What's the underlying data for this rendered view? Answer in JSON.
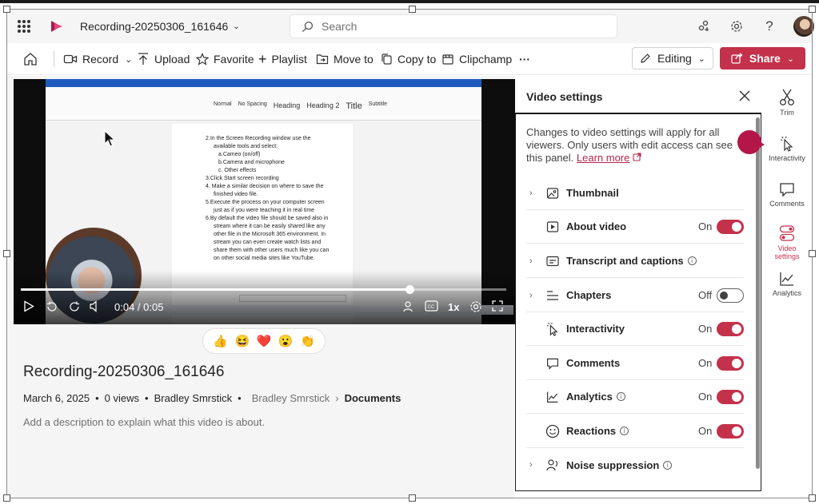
{
  "header": {
    "file_title": "Recording-20250306_161646",
    "search_placeholder": "Search"
  },
  "toolbar": {
    "record_label": "Record",
    "upload_label": "Upload",
    "favorite_label": "Favorite",
    "playlist_label": "Playlist",
    "move_label": "Move to",
    "copy_label": "Copy to",
    "clipchamp_label": "Clipchamp",
    "more_label": "···",
    "editing_label": "Editing",
    "share_label": "Share"
  },
  "player": {
    "time_display": "0:04 / 0:05",
    "progress": 0.8,
    "speed_label": "1x",
    "skip_back": "10",
    "skip_fwd": "10"
  },
  "document_in_video": {
    "ribbon_styles": [
      "Normal",
      "No Spacing",
      "Heading",
      "Heading 2",
      "Title",
      "Subtitle"
    ],
    "lines": [
      {
        "text": "2.In the Screen Recording window use the",
        "cls": ""
      },
      {
        "text": "available tools and select:",
        "cls": "ind2"
      },
      {
        "text": "a.Cameo (on/off)",
        "cls": "ind"
      },
      {
        "text": "b.Camera and microphone",
        "cls": "ind"
      },
      {
        "text": "c. Other effects",
        "cls": "ind"
      },
      {
        "text": "3.Click Start screen recording",
        "cls": ""
      },
      {
        "text": "4. Make a similar decision on where to save the",
        "cls": ""
      },
      {
        "text": "finished video file.",
        "cls": "ind2"
      },
      {
        "text": "5.Execute the process on your computer screen",
        "cls": ""
      },
      {
        "text": "just as if you were teaching it in real time",
        "cls": "ind2"
      },
      {
        "text": "6.By default the video file should be saved also in",
        "cls": ""
      },
      {
        "text": "stream where it can be easily shared like any",
        "cls": "ind2"
      },
      {
        "text": "other file in the Microsoft 365 environment. In",
        "cls": "ind2"
      },
      {
        "text": "stream you can even create watch lists and",
        "cls": "ind2"
      },
      {
        "text": "share them with other users much like you can",
        "cls": "ind2"
      },
      {
        "text": "on other social media sites like YouTube.",
        "cls": "ind2"
      }
    ]
  },
  "reactions": [
    "👍",
    "😆",
    "❤️",
    "😮",
    "👏"
  ],
  "video_info": {
    "title": "Recording-20250306_161646",
    "date": "March 6, 2025",
    "views": "0 views",
    "owner": "Bradley Smrstick",
    "location_owner": "Bradley Smrstick",
    "location_folder": "Documents",
    "description_placeholder": "Add a description to explain what this video is about."
  },
  "settings_panel": {
    "title": "Video settings",
    "info_text": "Changes to video settings will apply for all viewers. Only users with edit access can see this panel.",
    "learn_more": "Learn more",
    "rows": [
      {
        "label": "Thumbnail",
        "expandable": true,
        "state": null,
        "icon": "image-icon",
        "info": false
      },
      {
        "label": "About video",
        "expandable": false,
        "state": "On",
        "icon": "play-box-icon",
        "info": false
      },
      {
        "label": "Transcript and captions",
        "expandable": true,
        "state": null,
        "icon": "captions-icon",
        "info": true
      },
      {
        "label": "Chapters",
        "expandable": true,
        "state": "Off",
        "icon": "chapters-icon",
        "info": false
      },
      {
        "label": "Interactivity",
        "expandable": false,
        "state": "On",
        "icon": "cursor-sparkle-icon",
        "info": false
      },
      {
        "label": "Comments",
        "expandable": false,
        "state": "On",
        "icon": "comment-icon",
        "info": false
      },
      {
        "label": "Analytics",
        "expandable": false,
        "state": "On",
        "icon": "analytics-icon",
        "info": true
      },
      {
        "label": "Reactions",
        "expandable": false,
        "state": "On",
        "icon": "smiley-icon",
        "info": true
      },
      {
        "label": "Noise suppression",
        "expandable": true,
        "state": null,
        "icon": "noise-suppression-icon",
        "info": true
      }
    ]
  },
  "rail": {
    "trim": "Trim",
    "interactivity": "Interactivity",
    "comments": "Comments",
    "video_settings_1": "Video",
    "video_settings_2": "settings",
    "analytics": "Analytics"
  },
  "colors": {
    "accent": "#c4314b",
    "pointer": "#b4164a"
  }
}
